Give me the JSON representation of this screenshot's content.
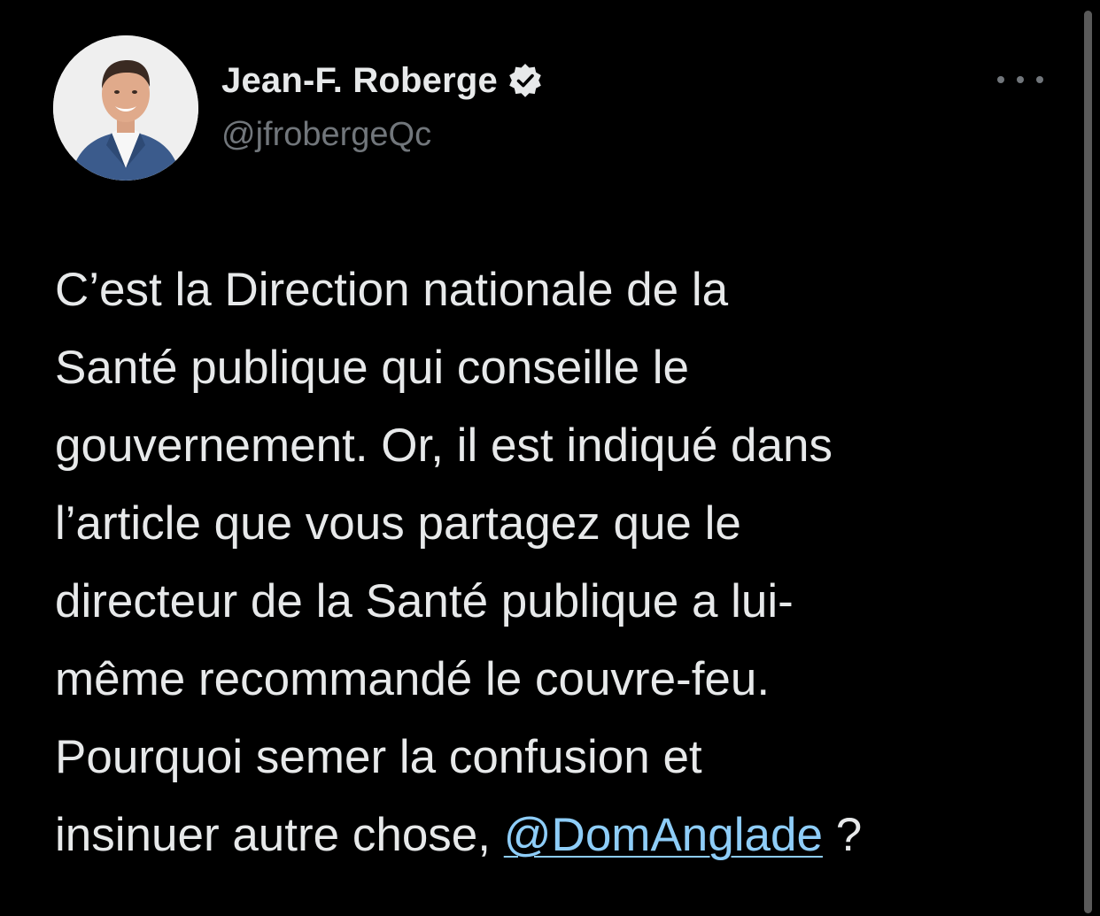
{
  "author": {
    "display_name": "Jean-F. Roberge",
    "handle": "@jfrobergeQc",
    "verified": true,
    "verified_icon": "verified-badge-icon"
  },
  "menu": {
    "icon": "more-horizontal-icon"
  },
  "tweet": {
    "lines": [
      "C’est la Direction nationale de la",
      "Santé publique qui conseille le",
      "gouvernement. Or, il est indiqué dans",
      "l’article que vous partagez que  le",
      "directeur de la Santé publique a lui-",
      "même recommandé le couvre-feu.",
      "Pourquoi semer la confusion et"
    ],
    "last_line_prefix": "insinuer autre chose, ",
    "mention": "@DomAnglade",
    "last_line_suffix": " ?"
  },
  "colors": {
    "background": "#000000",
    "text": "#e7e9ea",
    "secondary": "#71767b",
    "link": "#8ecdf8"
  }
}
